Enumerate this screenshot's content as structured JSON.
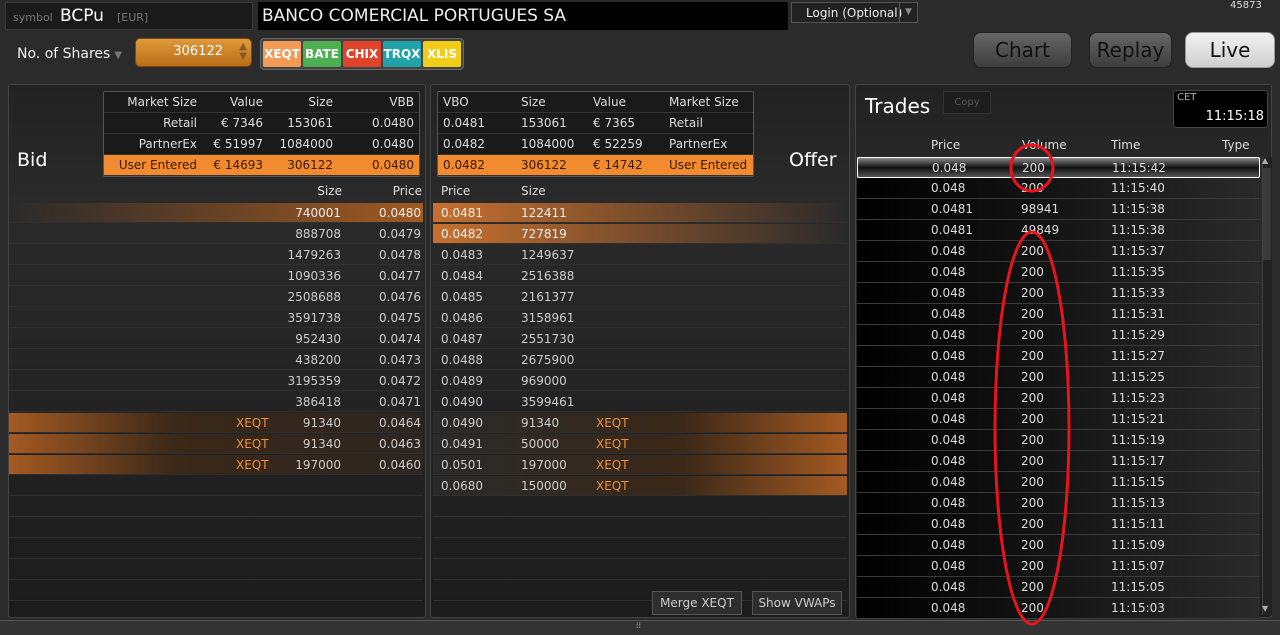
{
  "header": {
    "symbol_label": "symbol",
    "symbol": "BCPu",
    "currency": "[EUR]",
    "company": "BANCO COMERCIAL PORTUGUES SA",
    "login": "Login (Optional)",
    "session_id": "45873",
    "shares_label": "No. of Shares",
    "shares_value": "306122",
    "venues": [
      {
        "label": "XEQT",
        "color": "#f39a55"
      },
      {
        "label": "BATE",
        "color": "#4caf50"
      },
      {
        "label": "CHIX",
        "color": "#e0432c"
      },
      {
        "label": "TRQX",
        "color": "#1fa2a8"
      },
      {
        "label": "XLIS",
        "color": "#f2cd17"
      }
    ],
    "buttons": {
      "chart": "Chart",
      "replay": "Replay",
      "live": "Live"
    }
  },
  "bid": {
    "label": "Bid",
    "summary_headers": [
      "Market Size",
      "Value",
      "Size",
      "VBB"
    ],
    "summary": [
      [
        "Retail",
        "€ 7346",
        "153061",
        "0.0480"
      ],
      [
        "PartnerEx",
        "€ 51997",
        "1084000",
        "0.0480"
      ],
      [
        "User Entered",
        "€ 14693",
        "306122",
        "0.0480"
      ]
    ],
    "headers": {
      "size": "Size",
      "price": "Price"
    },
    "rows": [
      [
        "",
        "740001",
        "0.0480"
      ],
      [
        "",
        "888708",
        "0.0479"
      ],
      [
        "",
        "1479263",
        "0.0478"
      ],
      [
        "",
        "1090336",
        "0.0477"
      ],
      [
        "",
        "2508688",
        "0.0476"
      ],
      [
        "",
        "3591738",
        "0.0475"
      ],
      [
        "",
        "952430",
        "0.0474"
      ],
      [
        "",
        "438200",
        "0.0473"
      ],
      [
        "",
        "3195359",
        "0.0472"
      ],
      [
        "",
        "386418",
        "0.0471"
      ],
      [
        "XEQT",
        "91340",
        "0.0464"
      ],
      [
        "XEQT",
        "91340",
        "0.0463"
      ],
      [
        "XEQT",
        "197000",
        "0.0460"
      ]
    ]
  },
  "offer": {
    "label": "Offer",
    "summary_headers": [
      "VBO",
      "Size",
      "Value",
      "Market Size"
    ],
    "summary": [
      [
        "0.0481",
        "153061",
        "€ 7365",
        "Retail"
      ],
      [
        "0.0482",
        "1084000",
        "€ 52259",
        "PartnerEx"
      ],
      [
        "0.0482",
        "306122",
        "€ 14742",
        "User Entered"
      ]
    ],
    "headers": {
      "price": "Price",
      "size": "Size"
    },
    "rows": [
      [
        "0.0481",
        "122411",
        ""
      ],
      [
        "0.0482",
        "727819",
        ""
      ],
      [
        "0.0483",
        "1249637",
        ""
      ],
      [
        "0.0484",
        "2516388",
        ""
      ],
      [
        "0.0485",
        "2161377",
        ""
      ],
      [
        "0.0486",
        "3158961",
        ""
      ],
      [
        "0.0487",
        "2551730",
        ""
      ],
      [
        "0.0488",
        "2675900",
        ""
      ],
      [
        "0.0489",
        "969000",
        ""
      ],
      [
        "0.0490",
        "3599461",
        ""
      ],
      [
        "0.0490",
        "91340",
        "XEQT"
      ],
      [
        "0.0491",
        "50000",
        "XEQT"
      ],
      [
        "0.0501",
        "197000",
        "XEQT"
      ],
      [
        "0.0680",
        "150000",
        "XEQT"
      ]
    ],
    "merge_button": "Merge XEQT",
    "vwap_button": "Show VWAPs"
  },
  "trades": {
    "title": "Trades",
    "copy": "Copy",
    "timezone": "CET",
    "clock": "11:15:18",
    "headers": [
      "Price",
      "Volume",
      "Time",
      "Type"
    ],
    "rows": [
      [
        "0.048",
        "200",
        "11:15:42"
      ],
      [
        "0.048",
        "200",
        "11:15:40"
      ],
      [
        "0.0481",
        "98941",
        "11:15:38"
      ],
      [
        "0.0481",
        "49849",
        "11:15:38"
      ],
      [
        "0.048",
        "200",
        "11:15:37"
      ],
      [
        "0.048",
        "200",
        "11:15:35"
      ],
      [
        "0.048",
        "200",
        "11:15:33"
      ],
      [
        "0.048",
        "200",
        "11:15:31"
      ],
      [
        "0.048",
        "200",
        "11:15:29"
      ],
      [
        "0.048",
        "200",
        "11:15:27"
      ],
      [
        "0.048",
        "200",
        "11:15:25"
      ],
      [
        "0.048",
        "200",
        "11:15:23"
      ],
      [
        "0.048",
        "200",
        "11:15:21"
      ],
      [
        "0.048",
        "200",
        "11:15:19"
      ],
      [
        "0.048",
        "200",
        "11:15:17"
      ],
      [
        "0.048",
        "200",
        "11:15:15"
      ],
      [
        "0.048",
        "200",
        "11:15:13"
      ],
      [
        "0.048",
        "200",
        "11:15:11"
      ],
      [
        "0.048",
        "200",
        "11:15:09"
      ],
      [
        "0.048",
        "200",
        "11:15:07"
      ],
      [
        "0.048",
        "200",
        "11:15:05"
      ],
      [
        "0.048",
        "200",
        "11:15:03"
      ]
    ]
  },
  "annotation_color": "#e8141c"
}
